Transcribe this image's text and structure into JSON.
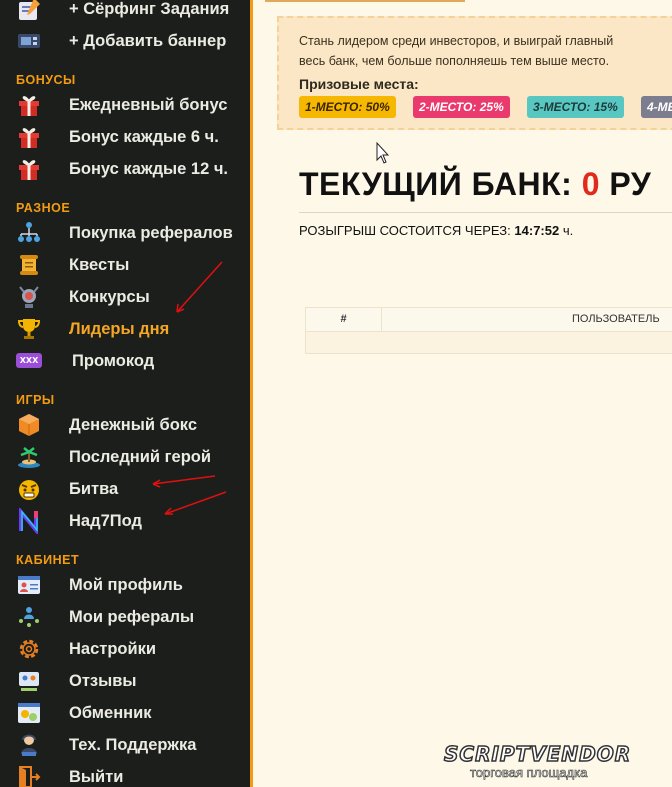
{
  "sidebar": {
    "top_items": [
      {
        "label": "+ Сёрфинг Задания",
        "icon": "surfing-icon"
      },
      {
        "label": "+ Добавить баннер",
        "icon": "banner-icon"
      }
    ],
    "sections": [
      {
        "title": "БОНУСЫ",
        "items": [
          {
            "label": "Ежедневный бонус",
            "icon": "gift-icon"
          },
          {
            "label": "Бонус каждые 6 ч.",
            "icon": "gift-icon"
          },
          {
            "label": "Бонус каждые 12 ч.",
            "icon": "gift-icon"
          }
        ]
      },
      {
        "title": "РАЗНОЕ",
        "items": [
          {
            "label": "Покупка рефералов",
            "icon": "referrals-icon"
          },
          {
            "label": "Квесты",
            "icon": "scroll-icon"
          },
          {
            "label": "Конкурсы",
            "icon": "contest-icon"
          },
          {
            "label": "Лидеры дня",
            "icon": "trophy-icon",
            "active": true
          },
          {
            "label": "Промокод",
            "icon": "promo-code-icon",
            "badge": "XXX"
          }
        ]
      },
      {
        "title": "ИГРЫ",
        "items": [
          {
            "label": "Денежный бокс",
            "icon": "money-box-icon"
          },
          {
            "label": "Последний герой",
            "icon": "island-icon"
          },
          {
            "label": "Битва",
            "icon": "angry-face-icon"
          },
          {
            "label": "Над7Под",
            "icon": "n-logo-icon"
          }
        ]
      },
      {
        "title": "КАБИНЕТ",
        "items": [
          {
            "label": "Мой профиль",
            "icon": "profile-icon"
          },
          {
            "label": "Мои рефералы",
            "icon": "my-referrals-icon"
          },
          {
            "label": "Настройки",
            "icon": "gear-icon"
          },
          {
            "label": "Отзывы",
            "icon": "reviews-icon"
          },
          {
            "label": "Обменник",
            "icon": "exchange-icon"
          },
          {
            "label": "Тех. Поддержка",
            "icon": "support-icon"
          },
          {
            "label": "Выйти",
            "icon": "logout-icon"
          }
        ]
      }
    ]
  },
  "info": {
    "line1": "Стань лидером среди инвесторов, и выиграй главный",
    "line2": "весь банк, чем больше пополняешь тем выше место.",
    "prize_title": "Призовые места:",
    "prizes": [
      {
        "label": "1-МЕСТО: 50%",
        "bg": "#f5b700",
        "fg": "#3b2600"
      },
      {
        "label": "2-МЕСТО: 25%",
        "bg": "#ea3a6d",
        "fg": "#ffffff"
      },
      {
        "label": "3-МЕСТО: 15%",
        "bg": "#58c7c2",
        "fg": "#1d3b3a"
      },
      {
        "label": "4-МЕ",
        "bg": "#7c7d8f",
        "fg": "#ffffff"
      }
    ]
  },
  "bank": {
    "label": "ТЕКУЩИЙ БАНК:",
    "amount": "0",
    "currency": "РУ"
  },
  "draw": {
    "label": "РОЗЫГРЫШ СОСТОИТСЯ ЧЕРЕЗ:",
    "time": "14:7:52",
    "unit": "ч."
  },
  "table": {
    "headers": [
      "#",
      "ПОЛЬЗОВАТЕЛЬ"
    ]
  },
  "watermark": {
    "brand": "SCRIPTVENDOR",
    "tagline": "торговая площадка"
  },
  "colors": {
    "sidebar_bg": "#1b1e1b",
    "accent": "#f39c12",
    "active_label": "#f5a623",
    "bank_amount": "#e02a1c",
    "annotation_arrow": "#e01010"
  }
}
